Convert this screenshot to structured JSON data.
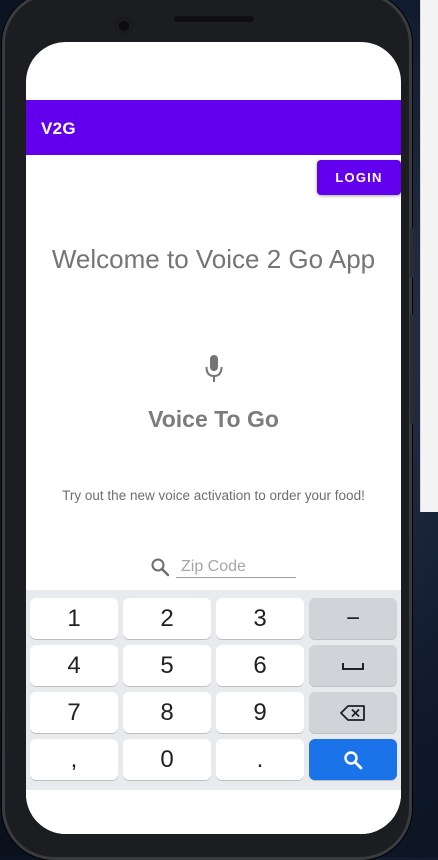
{
  "app": {
    "title": "V2G",
    "login_label": "LOGIN",
    "welcome_text": "Welcome to Voice 2 Go App",
    "voice_title": "Voice To Go",
    "tagline": "Try out the new voice activation to order your food!"
  },
  "zip_input": {
    "placeholder": "Zip Code",
    "value": ""
  },
  "keyboard": {
    "rows": [
      [
        "1",
        "2",
        "3",
        "−"
      ],
      [
        "4",
        "5",
        "6",
        "space-icon"
      ],
      [
        "7",
        "8",
        "9",
        "backspace-icon"
      ],
      [
        ",",
        "0",
        ".",
        "search-icon"
      ]
    ]
  },
  "colors": {
    "accent": "#6200ee",
    "keyboard_action": "#1a73e8",
    "keyboard_bg": "#e8eaed"
  }
}
